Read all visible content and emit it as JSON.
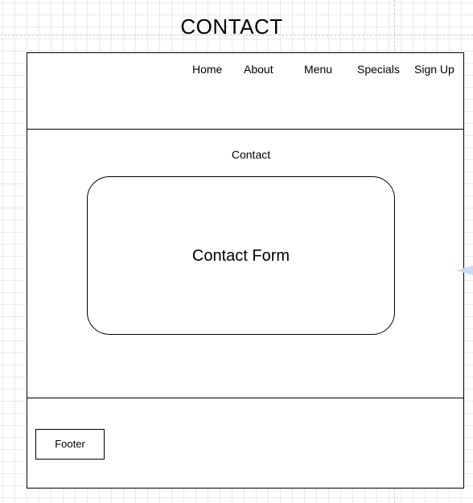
{
  "page": {
    "title": "CONTACT"
  },
  "nav": {
    "items": [
      {
        "label": "Home"
      },
      {
        "label": "About"
      },
      {
        "label": "Menu"
      },
      {
        "label": "Specials"
      },
      {
        "label": "Sign Up"
      }
    ]
  },
  "main": {
    "section_title": "Contact",
    "form_label": "Contact Form"
  },
  "footer": {
    "label": "Footer"
  },
  "colors": {
    "stroke": "#000000",
    "grid": "#d0d0d0",
    "guide": "#c8c8c8",
    "handle": "#c8ddf1"
  },
  "icons": {
    "handle": "connection-arrow-icon"
  }
}
